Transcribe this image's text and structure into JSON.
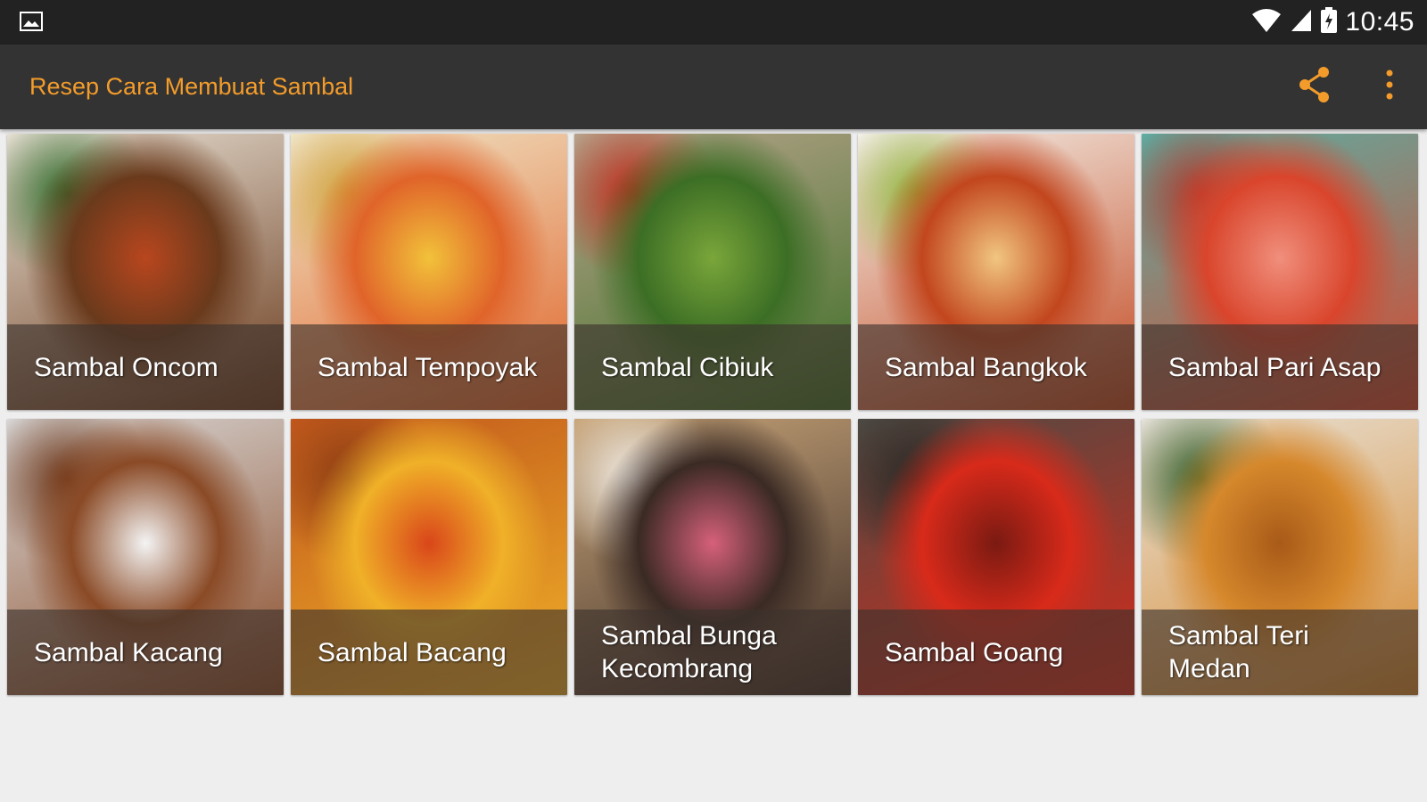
{
  "status_bar": {
    "notification_icon": "image-icon",
    "wifi_icon": "wifi-icon",
    "signal_icon": "signal-icon",
    "battery_icon": "battery-icon",
    "time": "10:45"
  },
  "app_bar": {
    "title": "Resep Cara Membuat Sambal",
    "share_icon": "share-icon",
    "menu_icon": "more-vert-icon"
  },
  "colors": {
    "accent": "#f39c2b",
    "status_bar_bg": "#222222",
    "app_bar_bg": "#333333",
    "page_bg": "#eeeeee"
  },
  "recipes": [
    {
      "name": "Sambal Oncom",
      "palette": [
        "#e9e2d6",
        "#6a3a1c",
        "#b8461e",
        "#2f6b2a"
      ]
    },
    {
      "name": "Sambal Tempoyak",
      "palette": [
        "#f0e6c8",
        "#e0642a",
        "#f2c23a",
        "#cfa23a"
      ]
    },
    {
      "name": "Sambal Cibiuk",
      "palette": [
        "#b8a48c",
        "#3c6e25",
        "#7aa63a",
        "#c0281a"
      ]
    },
    {
      "name": "Sambal Bangkok",
      "palette": [
        "#f4f1ea",
        "#c2461e",
        "#f1c680",
        "#8fb53a"
      ]
    },
    {
      "name": "Sambal Pari Asap",
      "palette": [
        "#5ab0a6",
        "#d9452c",
        "#f08f7c",
        "#b1382a"
      ]
    },
    {
      "name": "Sambal Kacang",
      "palette": [
        "#dadada",
        "#8a4a26",
        "#f4f4f4",
        "#6b3518"
      ]
    },
    {
      "name": "Sambal Bacang",
      "palette": [
        "#c1571c",
        "#f0b128",
        "#d9461a",
        "#8a3b13"
      ]
    },
    {
      "name": "Sambal Bunga Kecombrang",
      "palette": [
        "#c9a67a",
        "#3a2a24",
        "#d6607a",
        "#f5f1ea"
      ]
    },
    {
      "name": "Sambal Goang",
      "palette": [
        "#4c4a44",
        "#d82a1a",
        "#7a1a12",
        "#2a2824"
      ]
    },
    {
      "name": "Sambal Teri Medan",
      "palette": [
        "#e8e4dc",
        "#d6882c",
        "#a85a18",
        "#2f5a24"
      ]
    }
  ]
}
